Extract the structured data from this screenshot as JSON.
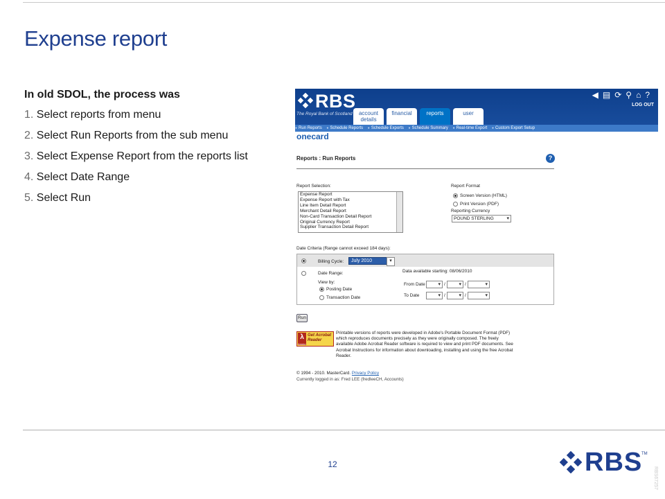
{
  "slide": {
    "title": "Expense report",
    "intro": "In old SDOL, the process was",
    "steps": [
      {
        "num": "1.",
        "text": "Select reports from menu"
      },
      {
        "num": "2.",
        "text": "Select Run Reports from the sub menu"
      },
      {
        "num": "3.",
        "text": "Select Expense Report from the reports list"
      },
      {
        "num": "4.",
        "text": "Select Date Range"
      },
      {
        "num": "5.",
        "text": "Select Run"
      }
    ],
    "page_number": "12",
    "footer_brand": "RBS",
    "footer_tm": "TM",
    "side_code": "RBS67257",
    "colors": {
      "brand_blue": "#1f3f8f",
      "banner_blue": "#0e3f8c"
    }
  },
  "app": {
    "brand": "RBS",
    "brand_tagline": "The Royal Bank of Scotland",
    "tabs": [
      "account details",
      "financial",
      "reports",
      "user"
    ],
    "active_tab": "reports",
    "toolbar_icons": [
      "back-icon",
      "print-icon",
      "refresh-icon",
      "search-icon",
      "home-icon",
      "help-icon"
    ],
    "logout_label": "LOG OUT",
    "subnav": [
      "Run Reports",
      "Schedule Reports",
      "Schedule Exports",
      "Schedule Summary",
      "Real-time Export",
      "Custom Export Setup"
    ],
    "product": "onecard",
    "page_heading": "Reports : Run Reports",
    "help_label": "?",
    "report_selection_label": "Report Selection:",
    "report_options": [
      "Expense Report",
      "Expense Report with Tax",
      "Line Item Detail Report",
      "Merchant Detail Report",
      "Non-Card Transaction Detail Report",
      "Original Currency Report",
      "Supplier Transaction Detail Report"
    ],
    "report_format_label": "Report Format",
    "format_options": [
      "Screen Version (HTML)",
      "Print Version (PDF)"
    ],
    "format_selected": "Screen Version (HTML)",
    "currency_label": "Reporting Currency",
    "currency_value": "POUND STERLING",
    "date_criteria_label": "Date Criteria (Range cannot exceed 184 days):",
    "billing_cycle_label": "Billing Cycle:",
    "billing_cycle_value": "July 2010",
    "date_range_label": "Date Range:",
    "data_available": "Data available starting: 08/06/2010",
    "view_by_label": "View by:",
    "view_by_options": [
      "Posting Date",
      "Transaction Date"
    ],
    "from_date_label": "From Date",
    "to_date_label": "To Date",
    "date_separator": "/",
    "run_label": "Run",
    "acrobat_badge": "Get Acrobat Reader",
    "acrobat_badge_adobe": "Adobe",
    "acrobat_text": "Printable versions of reports were developed in Adobe's Portable Document Format (PDF) which reproduces documents precisely as they were originally composed. The freely available Adobe Acrobat Reader software is required to view and print PDF documents. See Acrobat Instructions for information about downloading, installing and using the free Acrobat Reader.",
    "copyright": "© 1994 - 2010. MasterCard.",
    "privacy_label": "Privacy Policy",
    "logged_in": "Currently logged in as: Fred LEE (fredleeCH, Accounts)"
  }
}
